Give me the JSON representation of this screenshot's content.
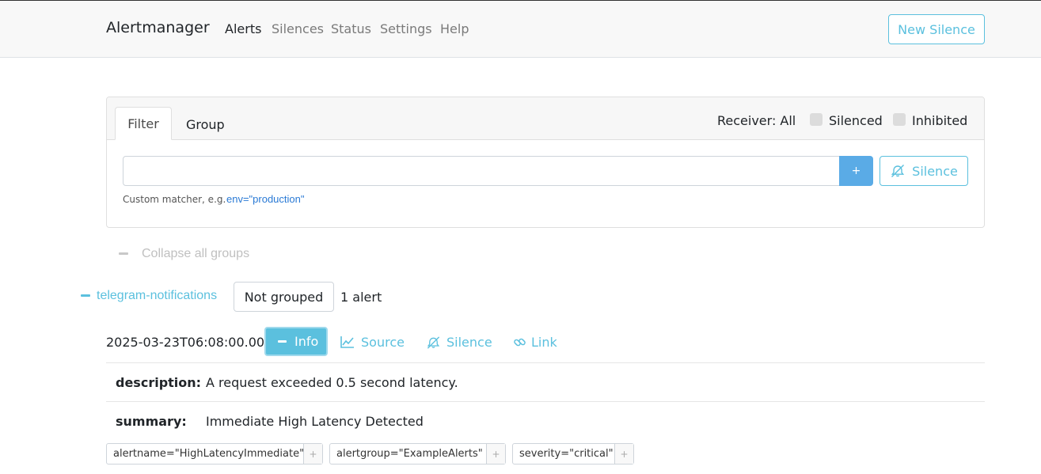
{
  "nav": {
    "brand": "Alertmanager",
    "links": [
      "Alerts",
      "Silences",
      "Status",
      "Settings",
      "Help"
    ],
    "active": "Alerts",
    "new_silence": "New Silence"
  },
  "filter": {
    "tabs": [
      "Filter",
      "Group"
    ],
    "receiver": "Receiver: All",
    "silenced": "Silenced",
    "inhibited": "Inhibited",
    "input_value": "",
    "plus": "+",
    "silence_button": "Silence",
    "hint_text": "Custom matcher, e.g.",
    "hint_example": "env=\"production\""
  },
  "collapse_all": "Collapse all groups",
  "group": {
    "name": "telegram-notifications",
    "grouping": "Not grouped",
    "count": "1 alert"
  },
  "alert": {
    "timestamp": "2025-03-23T06:08:00.000Z",
    "info": "Info",
    "source": "Source",
    "silence": "Silence",
    "link": "Link",
    "annotations": [
      {
        "key": "description:",
        "value": "A request exceeded 0.5 second latency."
      },
      {
        "key": "summary:",
        "value": "Immediate High Latency Detected"
      }
    ],
    "labels": [
      "alertname=\"HighLatencyImmediate\"",
      "alertgroup=\"ExampleAlerts\"",
      "severity=\"critical\""
    ],
    "label_plus": "+"
  },
  "colors": {
    "accent": "#5bc0de",
    "primary": "#5aabe6",
    "link": "#2a7ad5"
  }
}
